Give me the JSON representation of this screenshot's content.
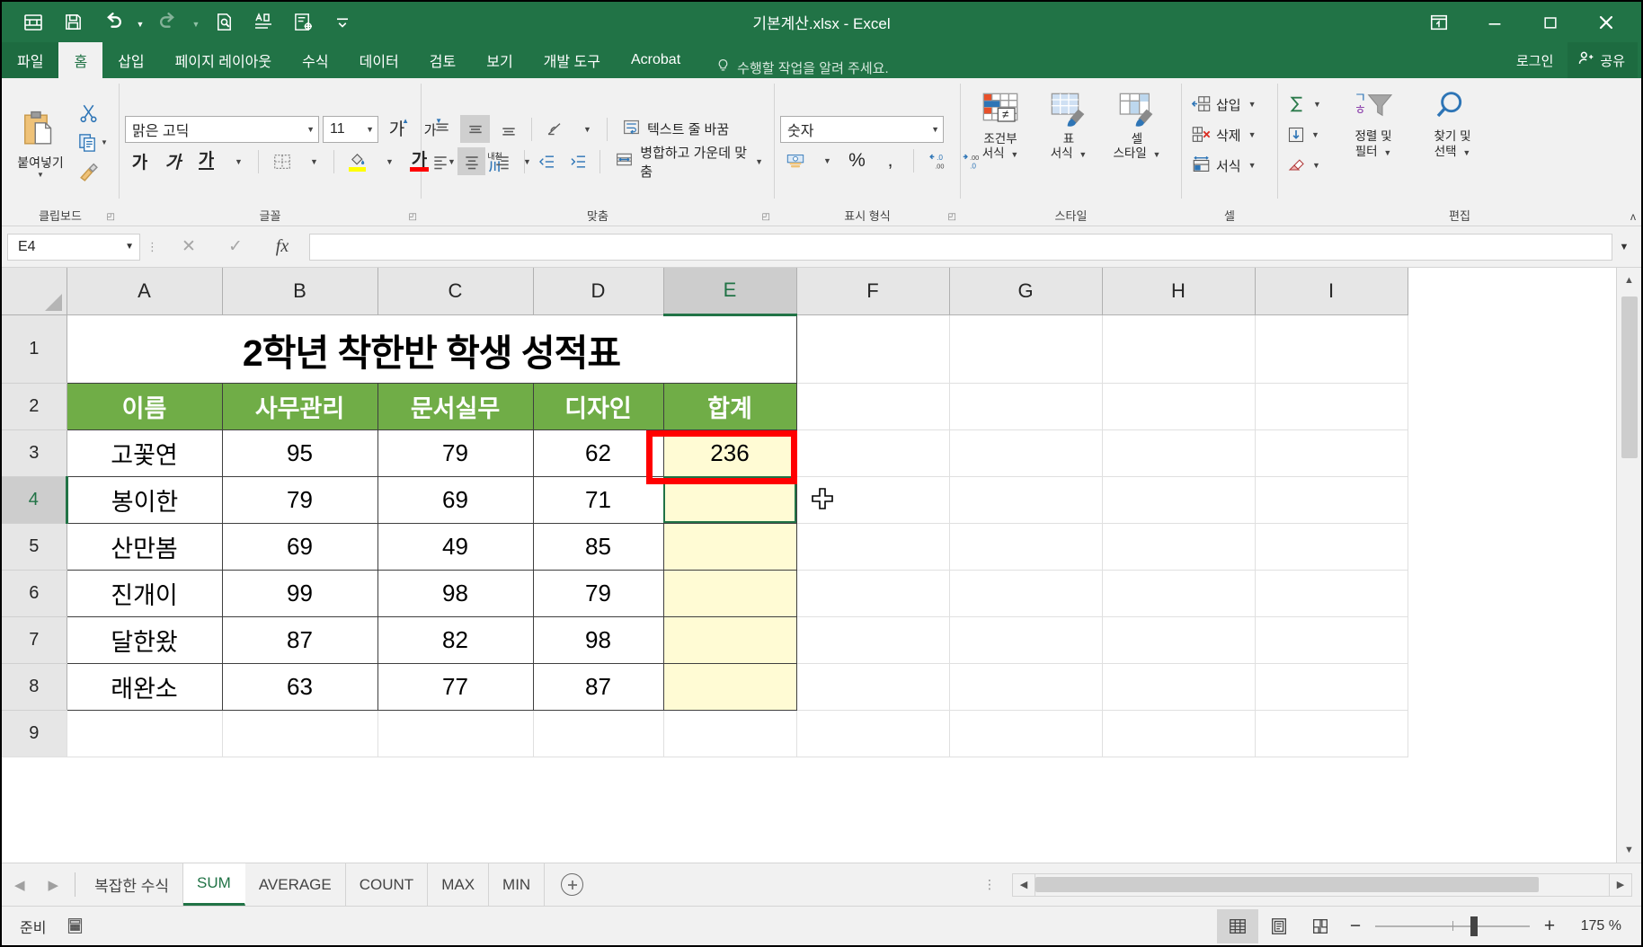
{
  "window": {
    "title": "기본계산.xlsx - Excel",
    "qat": [
      {
        "name": "autosave-icon",
        "label": ""
      },
      {
        "name": "save-icon",
        "label": ""
      },
      {
        "name": "undo-icon",
        "label": ""
      },
      {
        "name": "redo-icon",
        "label": ""
      },
      {
        "name": "print-preview-icon",
        "label": ""
      },
      {
        "name": "spelling-icon",
        "label": ""
      },
      {
        "name": "macro-icon",
        "label": ""
      },
      {
        "name": "customize-qat-icon",
        "label": ""
      }
    ],
    "controls": {
      "ribbon_display": "ribbon-display-options-icon",
      "minimize": "minimize-icon",
      "maximize": "maximize-icon",
      "close": "close-icon"
    }
  },
  "tabs": {
    "items": [
      {
        "label": "파일",
        "active": false
      },
      {
        "label": "홈",
        "active": true
      },
      {
        "label": "삽입",
        "active": false
      },
      {
        "label": "페이지 레이아웃",
        "active": false
      },
      {
        "label": "수식",
        "active": false
      },
      {
        "label": "데이터",
        "active": false
      },
      {
        "label": "검토",
        "active": false
      },
      {
        "label": "보기",
        "active": false
      },
      {
        "label": "개발 도구",
        "active": false
      },
      {
        "label": "Acrobat",
        "active": false
      }
    ],
    "tell_me": "수행할 작업을 알려 주세요.",
    "sign_in": "로그인",
    "share": "공유"
  },
  "ribbon": {
    "groups": [
      {
        "label": "클립보드"
      },
      {
        "label": "글꼴"
      },
      {
        "label": "맞춤"
      },
      {
        "label": "표시 형식"
      },
      {
        "label": "스타일"
      },
      {
        "label": "셀"
      },
      {
        "label": "편집"
      }
    ],
    "clipboard": {
      "paste": "붙여넣기",
      "cut": "잘라내기",
      "copy": "복사",
      "format_painter": "서식 복사"
    },
    "font": {
      "family": "맑은 고딕",
      "size": "11",
      "bold": "가",
      "italic": "가",
      "underline": "가",
      "border": "테두리",
      "fill_color": "채우기 색",
      "font_color": "글꼴 색",
      "grow": "가",
      "shrink": "가",
      "phonetic": "내천"
    },
    "alignment": {
      "wrap_text": "텍스트 줄 바꿈",
      "merge_center": "병합하고 가운데 맞춤",
      "orientation": "방향",
      "indent_decrease": "내어쓰기",
      "indent_increase": "들여쓰기"
    },
    "number": {
      "format": "숫자",
      "percent": "%",
      "comma": ",",
      "currency": "회계 표시 형식",
      "decrease_decimal": "자릿수 줄임",
      "increase_decimal": "자릿수 늘림"
    },
    "styles": {
      "conditional": "조건부\n서식",
      "conditional_l1": "조건부",
      "conditional_l2": "서식",
      "table_l1": "표",
      "table_l2": "서식",
      "cellstyle_l1": "셀",
      "cellstyle_l2": "스타일"
    },
    "cells": {
      "insert": "삽입",
      "delete": "삭제",
      "format": "서식"
    },
    "editing": {
      "autosum": "자동 합계",
      "fill": "채우기",
      "clear": "지우기",
      "sort_l1": "정렬 및",
      "sort_l2": "필터",
      "find_l1": "찾기 및",
      "find_l2": "선택"
    }
  },
  "formula_bar": {
    "name_box": "E4",
    "cancel": "cancel-icon",
    "enter": "enter-icon",
    "fx": "fx",
    "content": "",
    "placeholder": ""
  },
  "sheet": {
    "columns": [
      "A",
      "B",
      "C",
      "D",
      "E",
      "F",
      "G",
      "H",
      "I"
    ],
    "selected_column": "E",
    "rows": [
      "1",
      "2",
      "3",
      "4",
      "5",
      "6",
      "7",
      "8",
      "9"
    ],
    "selected_row": "4",
    "active_cell": "E4",
    "title_cell": "2학년 착한반 학생 성적표",
    "headers": [
      "이름",
      "사무관리",
      "문서실무",
      "디자인",
      "합계"
    ],
    "data": [
      {
        "name": "고꽃연",
        "c1": "95",
        "c2": "79",
        "c3": "62",
        "sum": "236"
      },
      {
        "name": "봉이한",
        "c1": "79",
        "c2": "69",
        "c3": "71",
        "sum": ""
      },
      {
        "name": "산만봄",
        "c1": "69",
        "c2": "49",
        "c3": "85",
        "sum": ""
      },
      {
        "name": "진개이",
        "c1": "99",
        "c2": "98",
        "c3": "79",
        "sum": ""
      },
      {
        "name": "달한왔",
        "c1": "87",
        "c2": "82",
        "c3": "98",
        "sum": ""
      },
      {
        "name": "래완소",
        "c1": "63",
        "c2": "77",
        "c3": "87",
        "sum": ""
      }
    ],
    "annotation": {
      "target_cell": "E3",
      "color": "#ff0000"
    },
    "colors": {
      "header_fill": "#70ad47",
      "sum_fill": "#fffbd4",
      "accent": "#217346",
      "grid_line": "#e0e0e0",
      "border": "#3f3f3f"
    }
  },
  "sheet_tabs": {
    "items": [
      {
        "label": "복잡한 수식",
        "active": false
      },
      {
        "label": "SUM",
        "active": true
      },
      {
        "label": "AVERAGE",
        "active": false
      },
      {
        "label": "COUNT",
        "active": false
      },
      {
        "label": "MAX",
        "active": false
      },
      {
        "label": "MIN",
        "active": false
      }
    ],
    "add_label": "+",
    "prev": "◀",
    "next": "▶"
  },
  "status_bar": {
    "state": "준비",
    "macro_icon": "record-macro-icon",
    "views": [
      {
        "name": "normal-view",
        "active": true
      },
      {
        "name": "page-layout-view",
        "active": false
      },
      {
        "name": "page-break-view",
        "active": false
      }
    ],
    "zoom_out": "−",
    "zoom_in": "+",
    "zoom_value": "175 %"
  }
}
